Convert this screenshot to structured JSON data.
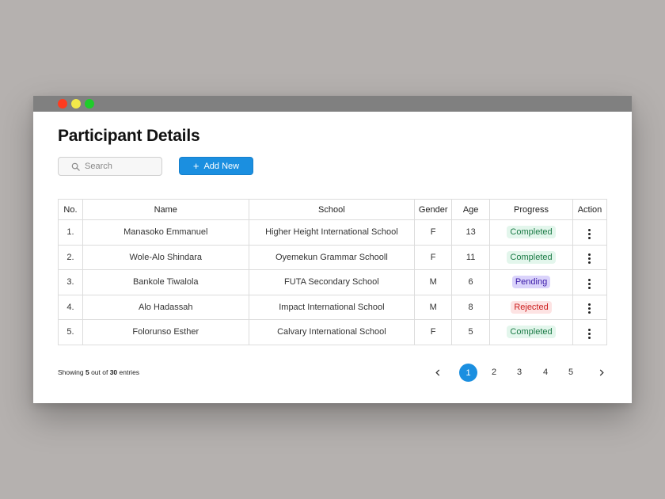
{
  "header": {
    "title": "Participant Details"
  },
  "search": {
    "placeholder": "Search"
  },
  "toolbar": {
    "add_icon": "plus-icon",
    "add_label": "Add New"
  },
  "table": {
    "columns": [
      "No.",
      "Name",
      "School",
      "Gender",
      "Age",
      "Progress",
      "Action"
    ],
    "rows": [
      {
        "no": "1.",
        "name": "Manasoko Emmanuel",
        "school": "Higher Height International School",
        "gender": "F",
        "age": "13",
        "progress": "Completed"
      },
      {
        "no": "2.",
        "name": "Wole-Alo Shindara",
        "school": "Oyemekun Grammar Schooll",
        "gender": "F",
        "age": "11",
        "progress": "Completed"
      },
      {
        "no": "3.",
        "name": "Bankole Tiwalola",
        "school": "FUTA Secondary School",
        "gender": "M",
        "age": "6",
        "progress": "Pending"
      },
      {
        "no": "4.",
        "name": "Alo Hadassah",
        "school": "Impact International School",
        "gender": "M",
        "age": "8",
        "progress": "Rejected"
      },
      {
        "no": "5.",
        "name": "Folorunso Esther",
        "school": "Calvary International School",
        "gender": "F",
        "age": "5",
        "progress": "Completed"
      }
    ]
  },
  "footer": {
    "showing_prefix": "Showing ",
    "shown_count": "5",
    "showing_middle": " out of ",
    "total_count": "30",
    "showing_suffix": " entries"
  },
  "pagination": {
    "pages": [
      "1",
      "2",
      "3",
      "4",
      "5"
    ],
    "current": "1"
  },
  "colors": {
    "accent": "#1b8fe0",
    "completed": "#1a7a45",
    "pending": "#3a1aa8",
    "rejected": "#cc1f1f"
  }
}
